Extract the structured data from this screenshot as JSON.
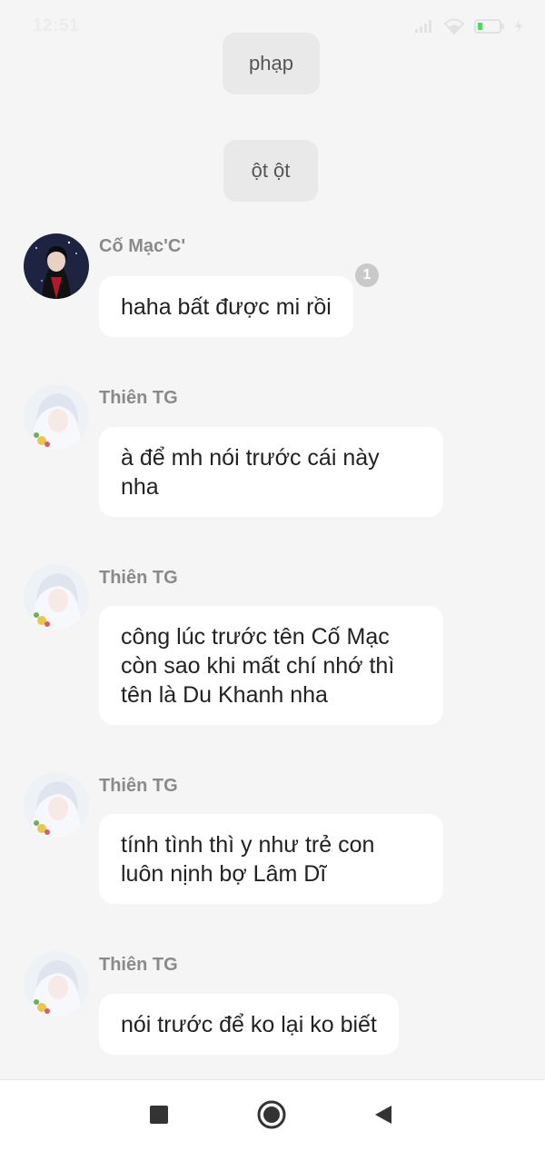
{
  "status_bar": {
    "time": "12:51",
    "icons": [
      "signal-icon",
      "wifi-icon",
      "battery-icon",
      "charging-icon"
    ]
  },
  "messages": {
    "sticker_1": "phạp",
    "sticker_2": "ột ột",
    "items": [
      {
        "sender": "Cố Mạc'C'",
        "text": "haha bất được mi rồi",
        "badge": "1"
      },
      {
        "sender": "Thiên TG",
        "text": "à để mh nói trước cái này\nnha"
      },
      {
        "sender": "Thiên TG",
        "text": "công lúc trước tên Cố Mạc\ncòn sao khi mất chí nhớ thì\ntên là Du Khanh nha"
      },
      {
        "sender": "Thiên TG",
        "text": "tính tình thì y như trẻ con\nluôn nịnh bợ Lâm Dĩ"
      },
      {
        "sender": "Thiên TG",
        "text": "nói trước để ko lại ko biết"
      }
    ]
  },
  "nav_bar": {
    "buttons": [
      "recent-apps-button",
      "home-button",
      "back-button"
    ]
  },
  "colors": {
    "background": "#f5f5f5",
    "bubble": "#ffffff",
    "sticker_bubble": "#e9e9e9",
    "name_text": "#8a8a8a",
    "badge": "#c9c9c9",
    "battery_level": "#4cd964"
  }
}
